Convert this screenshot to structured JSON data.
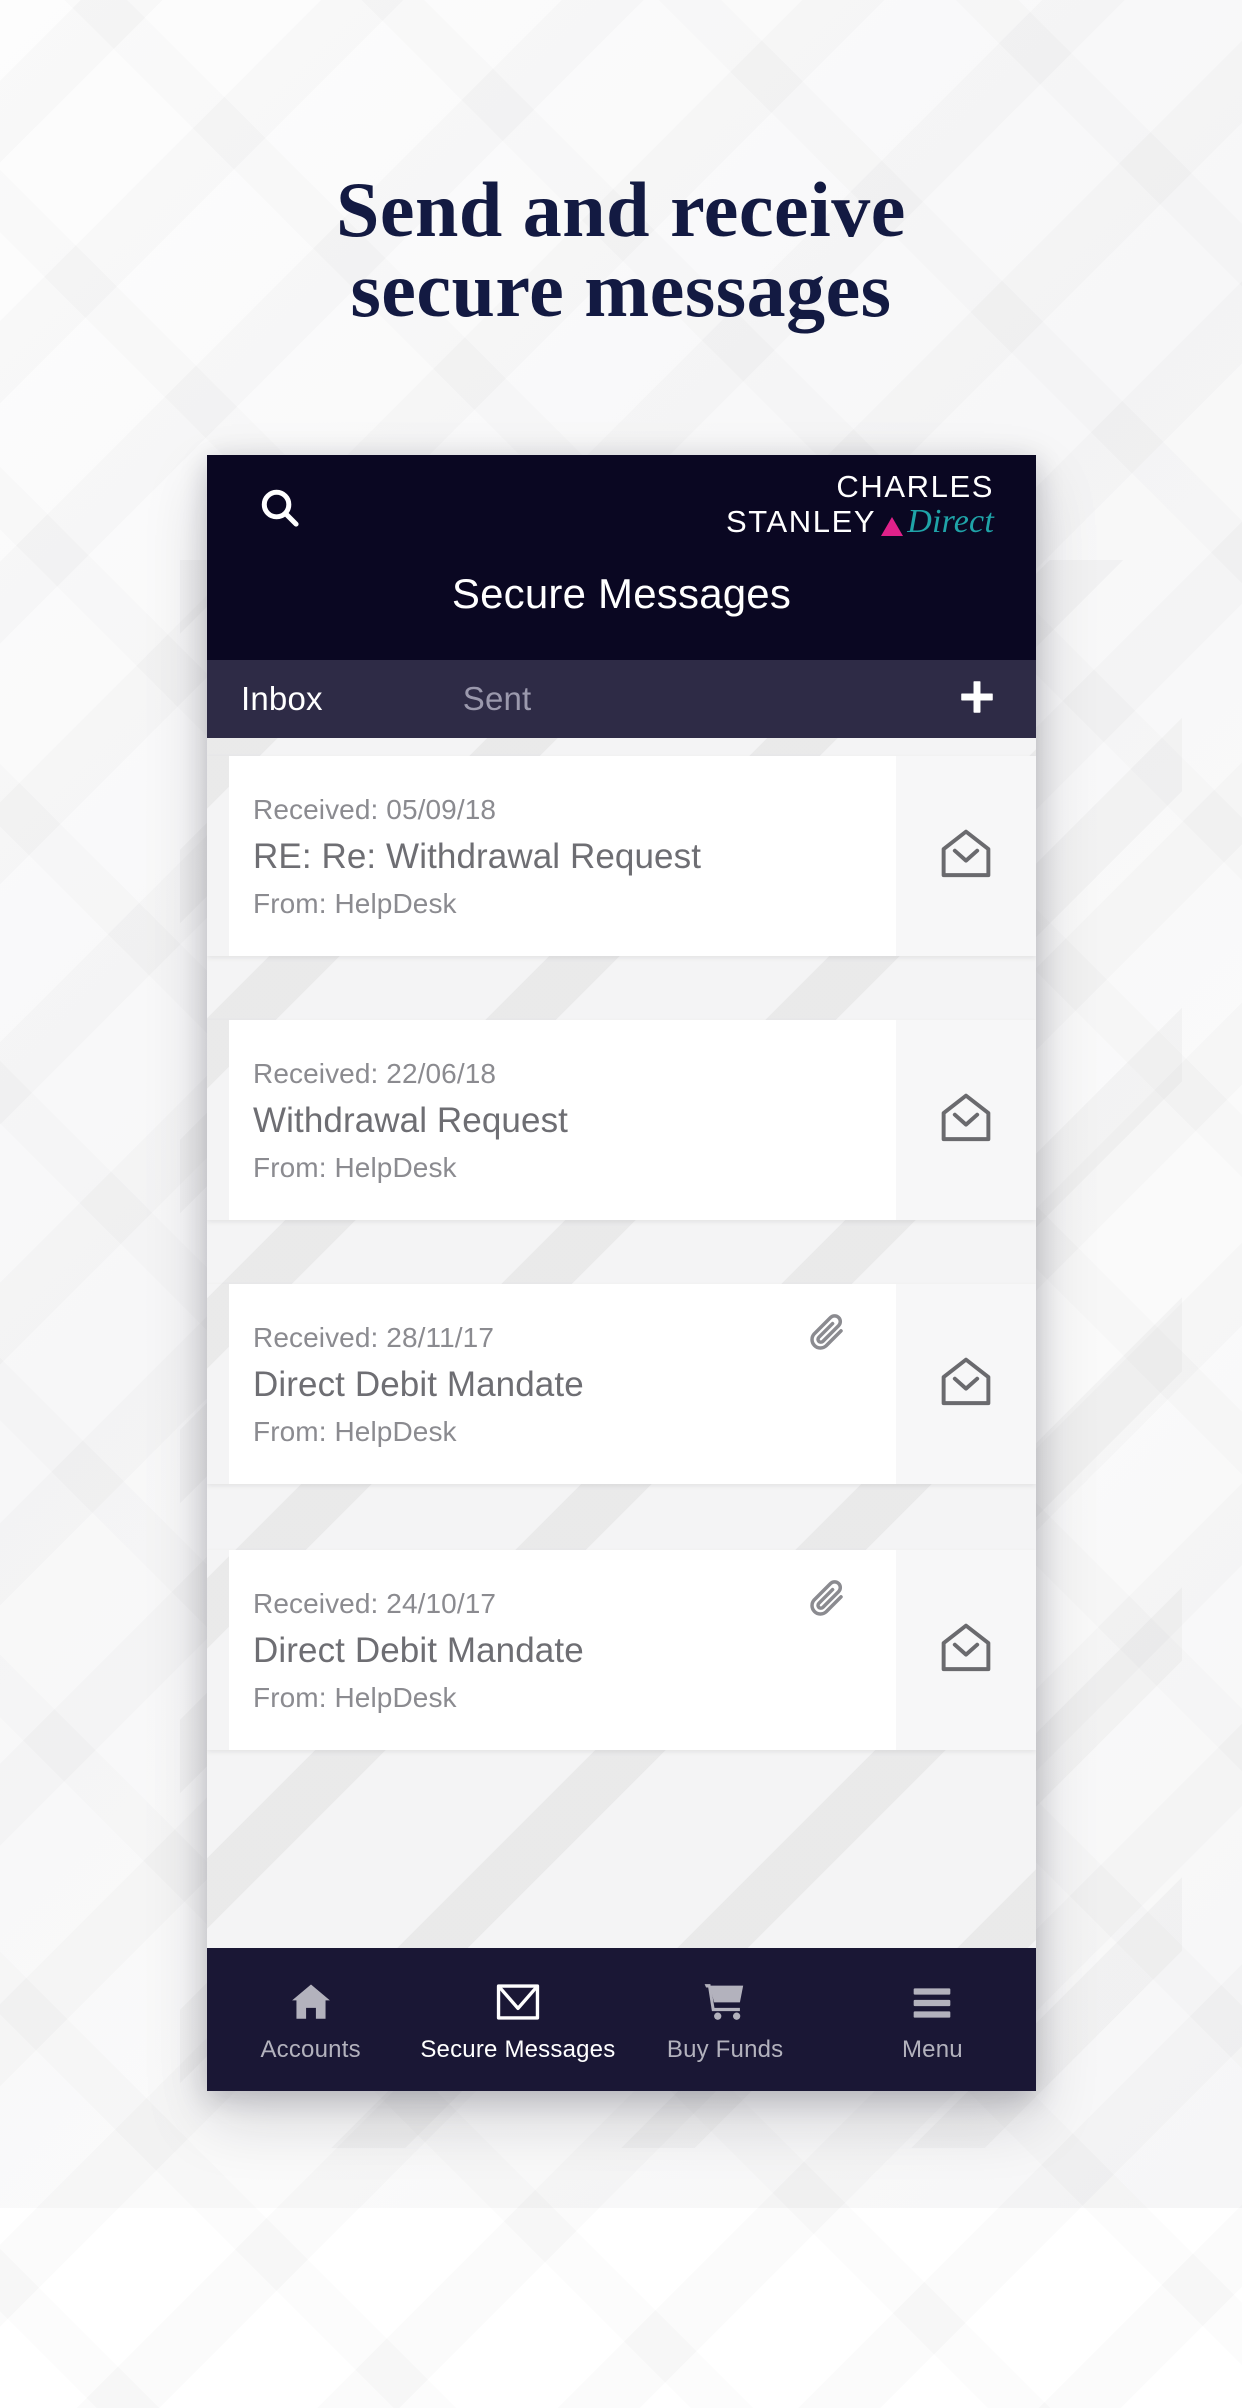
{
  "headline": {
    "line1": "Send and receive",
    "line2": "secure messages",
    "color": "#131a42"
  },
  "phone": {
    "header": {
      "search_icon": "search-icon",
      "brand": {
        "line1": "CHARLES",
        "line2": "STANLEY",
        "triangle_color": "#e0218a",
        "direct": "Direct",
        "direct_color": "#1fa3a8"
      },
      "title": "Secure Messages",
      "background_color": "#0a0722"
    },
    "tabs": {
      "background_color": "#2e2b46",
      "items": [
        {
          "label": "Inbox",
          "active": true
        },
        {
          "label": "Sent",
          "active": false
        }
      ],
      "compose_icon": "plus-icon"
    },
    "messages": [
      {
        "received": "Received: 05/09/18",
        "subject": "RE: Re: Withdrawal Request",
        "from": "From: HelpDesk",
        "attachment": false,
        "status_icon": "open-envelope-icon"
      },
      {
        "received": "Received: 22/06/18",
        "subject": "Withdrawal Request",
        "from": "From: HelpDesk",
        "attachment": false,
        "status_icon": "open-envelope-icon"
      },
      {
        "received": "Received: 28/11/17",
        "subject": "Direct Debit Mandate",
        "from": "From: HelpDesk",
        "attachment": true,
        "status_icon": "open-envelope-icon"
      },
      {
        "received": "Received: 24/10/17",
        "subject": "Direct Debit Mandate",
        "from": "From: HelpDesk",
        "attachment": true,
        "status_icon": "open-envelope-icon"
      }
    ],
    "bottom_nav": {
      "background_color": "#1a1735",
      "items": [
        {
          "label": "Accounts",
          "icon": "home-icon",
          "active": false
        },
        {
          "label": "Secure Messages",
          "icon": "envelope-icon",
          "active": true
        },
        {
          "label": "Buy Funds",
          "icon": "cart-icon",
          "active": false
        },
        {
          "label": "Menu",
          "icon": "hamburger-icon",
          "active": false
        }
      ]
    }
  }
}
